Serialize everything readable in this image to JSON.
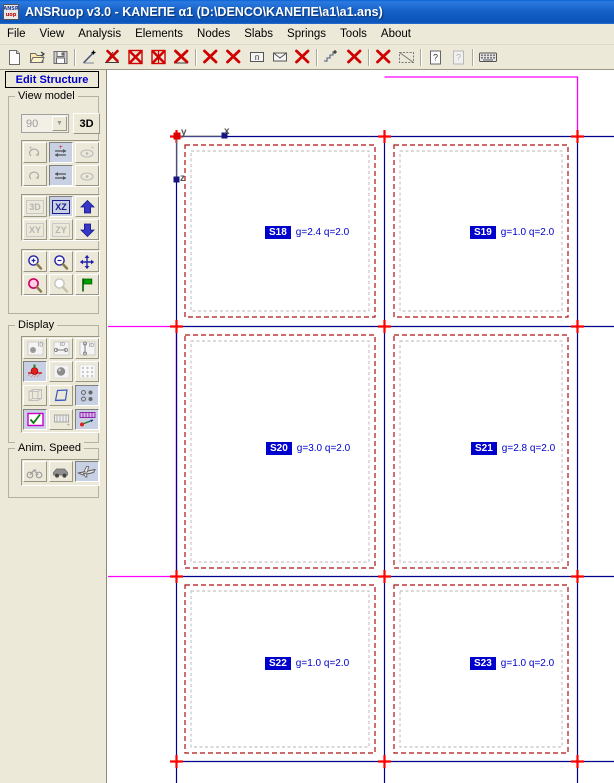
{
  "window": {
    "title": "ANSRuop v3.0 - ΚΑΝΕΠΕ α1 (D:\\DENCO\\ΚΑΝΕΠΕ\\a1\\a1.ans)",
    "icon_line1": "ANSR",
    "icon_line2": "uop"
  },
  "menubar": {
    "items": [
      {
        "label": "File"
      },
      {
        "label": "View"
      },
      {
        "label": "Analysis"
      },
      {
        "label": "Elements"
      },
      {
        "label": "Nodes"
      },
      {
        "label": "Slabs"
      },
      {
        "label": "Springs"
      },
      {
        "label": "Tools"
      },
      {
        "label": "About"
      }
    ]
  },
  "toolbar": {
    "buttons": [
      {
        "name": "new-file-icon",
        "kind": "page"
      },
      {
        "name": "open-file-icon",
        "kind": "folder"
      },
      {
        "name": "save-file-icon",
        "kind": "disk"
      },
      {
        "name": "separator",
        "kind": "sep"
      },
      {
        "name": "add-element-icon",
        "kind": "line-plus"
      },
      {
        "name": "delete-element-icon",
        "kind": "x-line"
      },
      {
        "name": "delete-slab-icon",
        "kind": "x-box"
      },
      {
        "name": "delete-wall-icon",
        "kind": "x-boxh"
      },
      {
        "name": "delete-all-elements-icon",
        "kind": "x-big"
      },
      {
        "name": "separator",
        "kind": "sep"
      },
      {
        "name": "delete-node-icon",
        "kind": "x-plain"
      },
      {
        "name": "delete-nodes-icon",
        "kind": "x-plain"
      },
      {
        "name": "column-icon",
        "kind": "box-n"
      },
      {
        "name": "beam-icon",
        "kind": "envelope"
      },
      {
        "name": "delete-beam-icon",
        "kind": "x-plain"
      },
      {
        "name": "separator",
        "kind": "sep"
      },
      {
        "name": "add-spring-icon",
        "kind": "stair-plus"
      },
      {
        "name": "delete-spring-icon",
        "kind": "x-plain"
      },
      {
        "name": "separator",
        "kind": "sep"
      },
      {
        "name": "delete-support-icon",
        "kind": "x-plain"
      },
      {
        "name": "select-region-icon",
        "kind": "dashbox"
      },
      {
        "name": "separator",
        "kind": "sep"
      },
      {
        "name": "help-icon",
        "kind": "question-page"
      },
      {
        "name": "about-icon",
        "kind": "question-dim"
      },
      {
        "name": "separator",
        "kind": "sep"
      },
      {
        "name": "keyboard-icon",
        "kind": "keyboard"
      }
    ]
  },
  "sidebar": {
    "tab_label": "Edit Structure",
    "view_model": {
      "title": "View model",
      "angle_value": "90",
      "button_3d_label": "3D",
      "rotate_buttons": [
        {
          "name": "rotate-up-icon",
          "selected": false
        },
        {
          "name": "rotate-horizontal-plus-icon",
          "selected": true
        },
        {
          "name": "perspective-plus-icon",
          "selected": false
        },
        {
          "name": "rotate-down-icon",
          "selected": false
        },
        {
          "name": "rotate-horizontal-minus-icon",
          "selected": true
        },
        {
          "name": "perspective-minus-icon",
          "selected": false
        }
      ],
      "plane_buttons": [
        {
          "name": "view-3d-icon",
          "label": "3D",
          "selected": false,
          "dim": true
        },
        {
          "name": "view-xz-icon",
          "label": "XZ",
          "selected": true,
          "dim": false
        },
        {
          "name": "level-up-icon",
          "label": "",
          "selected": false,
          "dim": false
        },
        {
          "name": "view-xy-icon",
          "label": "XY",
          "selected": false,
          "dim": true
        },
        {
          "name": "view-zy-icon",
          "label": "ZY",
          "selected": false,
          "dim": true
        },
        {
          "name": "level-down-icon",
          "label": "",
          "selected": false,
          "dim": false
        }
      ],
      "zoom_buttons": [
        {
          "name": "zoom-in-icon"
        },
        {
          "name": "zoom-out-icon"
        },
        {
          "name": "pan-icon"
        },
        {
          "name": "zoom-window-icon"
        },
        {
          "name": "zoom-previous-icon"
        },
        {
          "name": "zoom-extents-flag-icon"
        }
      ]
    },
    "display": {
      "title": "Display",
      "buttons": [
        {
          "name": "show-node-ids-icon"
        },
        {
          "name": "show-element-ids-icon"
        },
        {
          "name": "show-column-ids-icon"
        },
        {
          "name": "show-loads-icon",
          "selected": true
        },
        {
          "name": "show-masses-icon"
        },
        {
          "name": "show-mesh-icon"
        },
        {
          "name": "show-wireframe-icon"
        },
        {
          "name": "show-deformed-icon"
        },
        {
          "name": "show-nodes-icon",
          "selected": true
        },
        {
          "name": "show-checkbox-icon",
          "selected": true
        },
        {
          "name": "show-slab-icon"
        },
        {
          "name": "show-slab-loads-icon",
          "selected": true
        }
      ]
    },
    "anim_speed": {
      "title": "Anim. Speed",
      "buttons": [
        {
          "name": "speed-slow-icon",
          "selected": false
        },
        {
          "name": "speed-medium-icon",
          "selected": false
        },
        {
          "name": "speed-fast-icon",
          "selected": true
        }
      ]
    }
  },
  "canvas": {
    "axes": [
      {
        "label": "y",
        "name": "axis-label-y"
      },
      {
        "label": "x",
        "name": "axis-label-x"
      },
      {
        "label": "z",
        "name": "axis-label-z"
      }
    ],
    "slabs": [
      {
        "id": "S18",
        "loads": "g=2.4 q=2.0"
      },
      {
        "id": "S19",
        "loads": "g=1.0 q=2.0"
      },
      {
        "id": "S20",
        "loads": "g=3.0 q=2.0"
      },
      {
        "id": "S21",
        "loads": "g=2.8 q=2.0"
      },
      {
        "id": "S22",
        "loads": "g=1.0 q=2.0"
      },
      {
        "id": "S23",
        "loads": "g=1.0 q=2.0"
      }
    ],
    "colors": {
      "beam": "#00008b",
      "slab_outline": "#c00000",
      "slab_inner": "#b0b0b0",
      "node": "#ff0000",
      "selection": "#ff00ff",
      "label_bg": "#0000cc",
      "label_fg": "#ffffff"
    }
  }
}
